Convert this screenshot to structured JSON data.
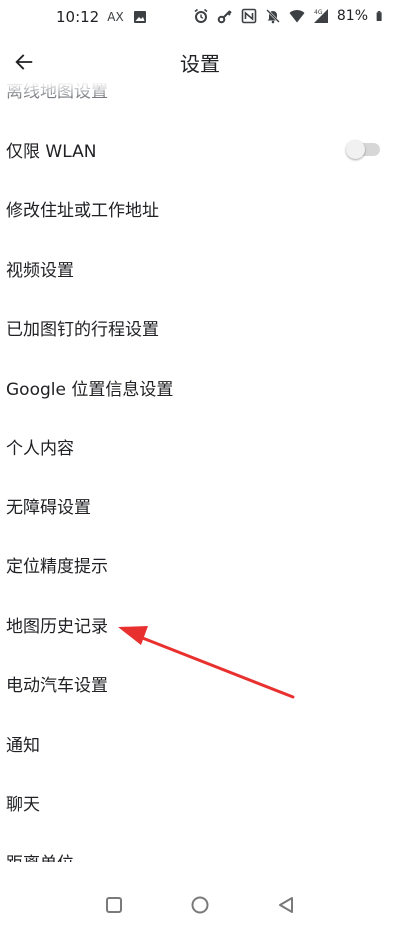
{
  "status_bar": {
    "time": "10:12",
    "carrier_badge": "AX",
    "battery_percent": "81%",
    "icons": [
      "image-icon",
      "alarm-icon",
      "key-icon",
      "nfc-icon",
      "mute-icon",
      "wifi-icon",
      "signal-4g-icon",
      "battery-icon"
    ]
  },
  "app_bar": {
    "title": "设置",
    "back_icon": "arrow-left-icon"
  },
  "settings": {
    "items": [
      {
        "label": "离线地图设置"
      },
      {
        "label": "仅限 WLAN",
        "toggle": {
          "on": false
        }
      },
      {
        "label": "修改住址或工作地址"
      },
      {
        "label": "视频设置"
      },
      {
        "label": "已加图钉的行程设置"
      },
      {
        "label": "Google 位置信息设置"
      },
      {
        "label": "个人内容"
      },
      {
        "label": "无障碍设置"
      },
      {
        "label": "定位精度提示"
      },
      {
        "label": "地图历史记录"
      },
      {
        "label": "电动汽车设置"
      },
      {
        "label": "通知"
      },
      {
        "label": "聊天"
      },
      {
        "label": "距离单位"
      }
    ]
  },
  "annotation": {
    "color": "#e8312f",
    "points_to": "地图历史记录"
  },
  "nav_bar": {
    "icons": [
      "recents-square-icon",
      "home-circle-icon",
      "back-triangle-icon"
    ]
  },
  "colors": {
    "text": "#202124",
    "background": "#ffffff",
    "toggle_off_track": "#d7d7d7",
    "arrow": "#e8312f"
  }
}
